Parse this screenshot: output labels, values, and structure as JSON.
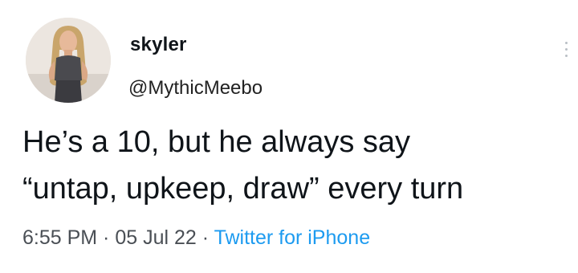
{
  "user": {
    "display_name": "skyler",
    "handle": "@MythicMeebo"
  },
  "tweet": {
    "line1": "He’s a 10, but he always say",
    "line2": "“untap, upkeep, draw” every turn"
  },
  "meta": {
    "time": "6:55 PM",
    "separator": " · ",
    "date": "05 Jul 22",
    "source": "Twitter for iPhone"
  },
  "colors": {
    "link": "#1d9bf0",
    "text": "#0f1419",
    "muted": "#4a4f55"
  }
}
